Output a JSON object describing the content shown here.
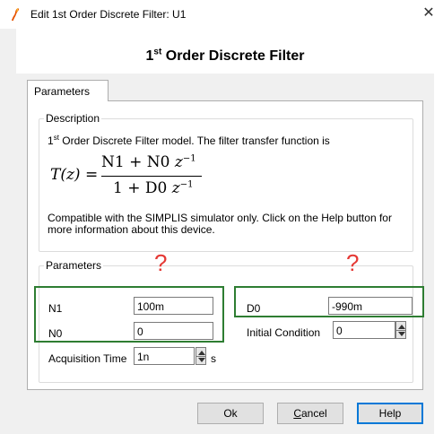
{
  "window": {
    "title": "Edit 1st Order Discrete Filter: U1",
    "close_glyph": "✕"
  },
  "header": {
    "heading_prefix": "1",
    "heading_sup": "st",
    "heading_rest": " Order Discrete Filter"
  },
  "tabs": [
    {
      "label": "Parameters"
    }
  ],
  "description": {
    "legend": "Description",
    "line1_prefix": "1",
    "line1_sup": "st",
    "line1_rest": " Order Discrete Filter model. The filter transfer function is",
    "formula": {
      "lhs": "T(z) =",
      "num_text": "N1 + N0 ",
      "den_text": "1 + D0 ",
      "var": "z",
      "exponent": "−1"
    },
    "line2": "Compatible with the SIMPLIS simulator only. Click on the Help button for more information about this device."
  },
  "parameters": {
    "legend": "Parameters",
    "n1": {
      "label": "N1",
      "value": "100m"
    },
    "n0": {
      "label": "N0",
      "value": "0"
    },
    "d0": {
      "label": "D0",
      "value": "-990m"
    },
    "initial_condition": {
      "label": "Initial Condition",
      "value": "0"
    },
    "acquisition_time": {
      "label": "Acquisition Time",
      "value": "1n",
      "unit": "s"
    }
  },
  "annotations": {
    "question_mark": "?",
    "highlight_color": "#2e7d32",
    "question_color": "#e53935"
  },
  "buttons": {
    "ok": "Ok",
    "cancel_underlined": "C",
    "cancel_rest": "ancel",
    "help": "Help"
  },
  "icons": {
    "app": "simplis-logo-icon",
    "close": "close-icon",
    "spin": "spin-arrows-icon"
  }
}
